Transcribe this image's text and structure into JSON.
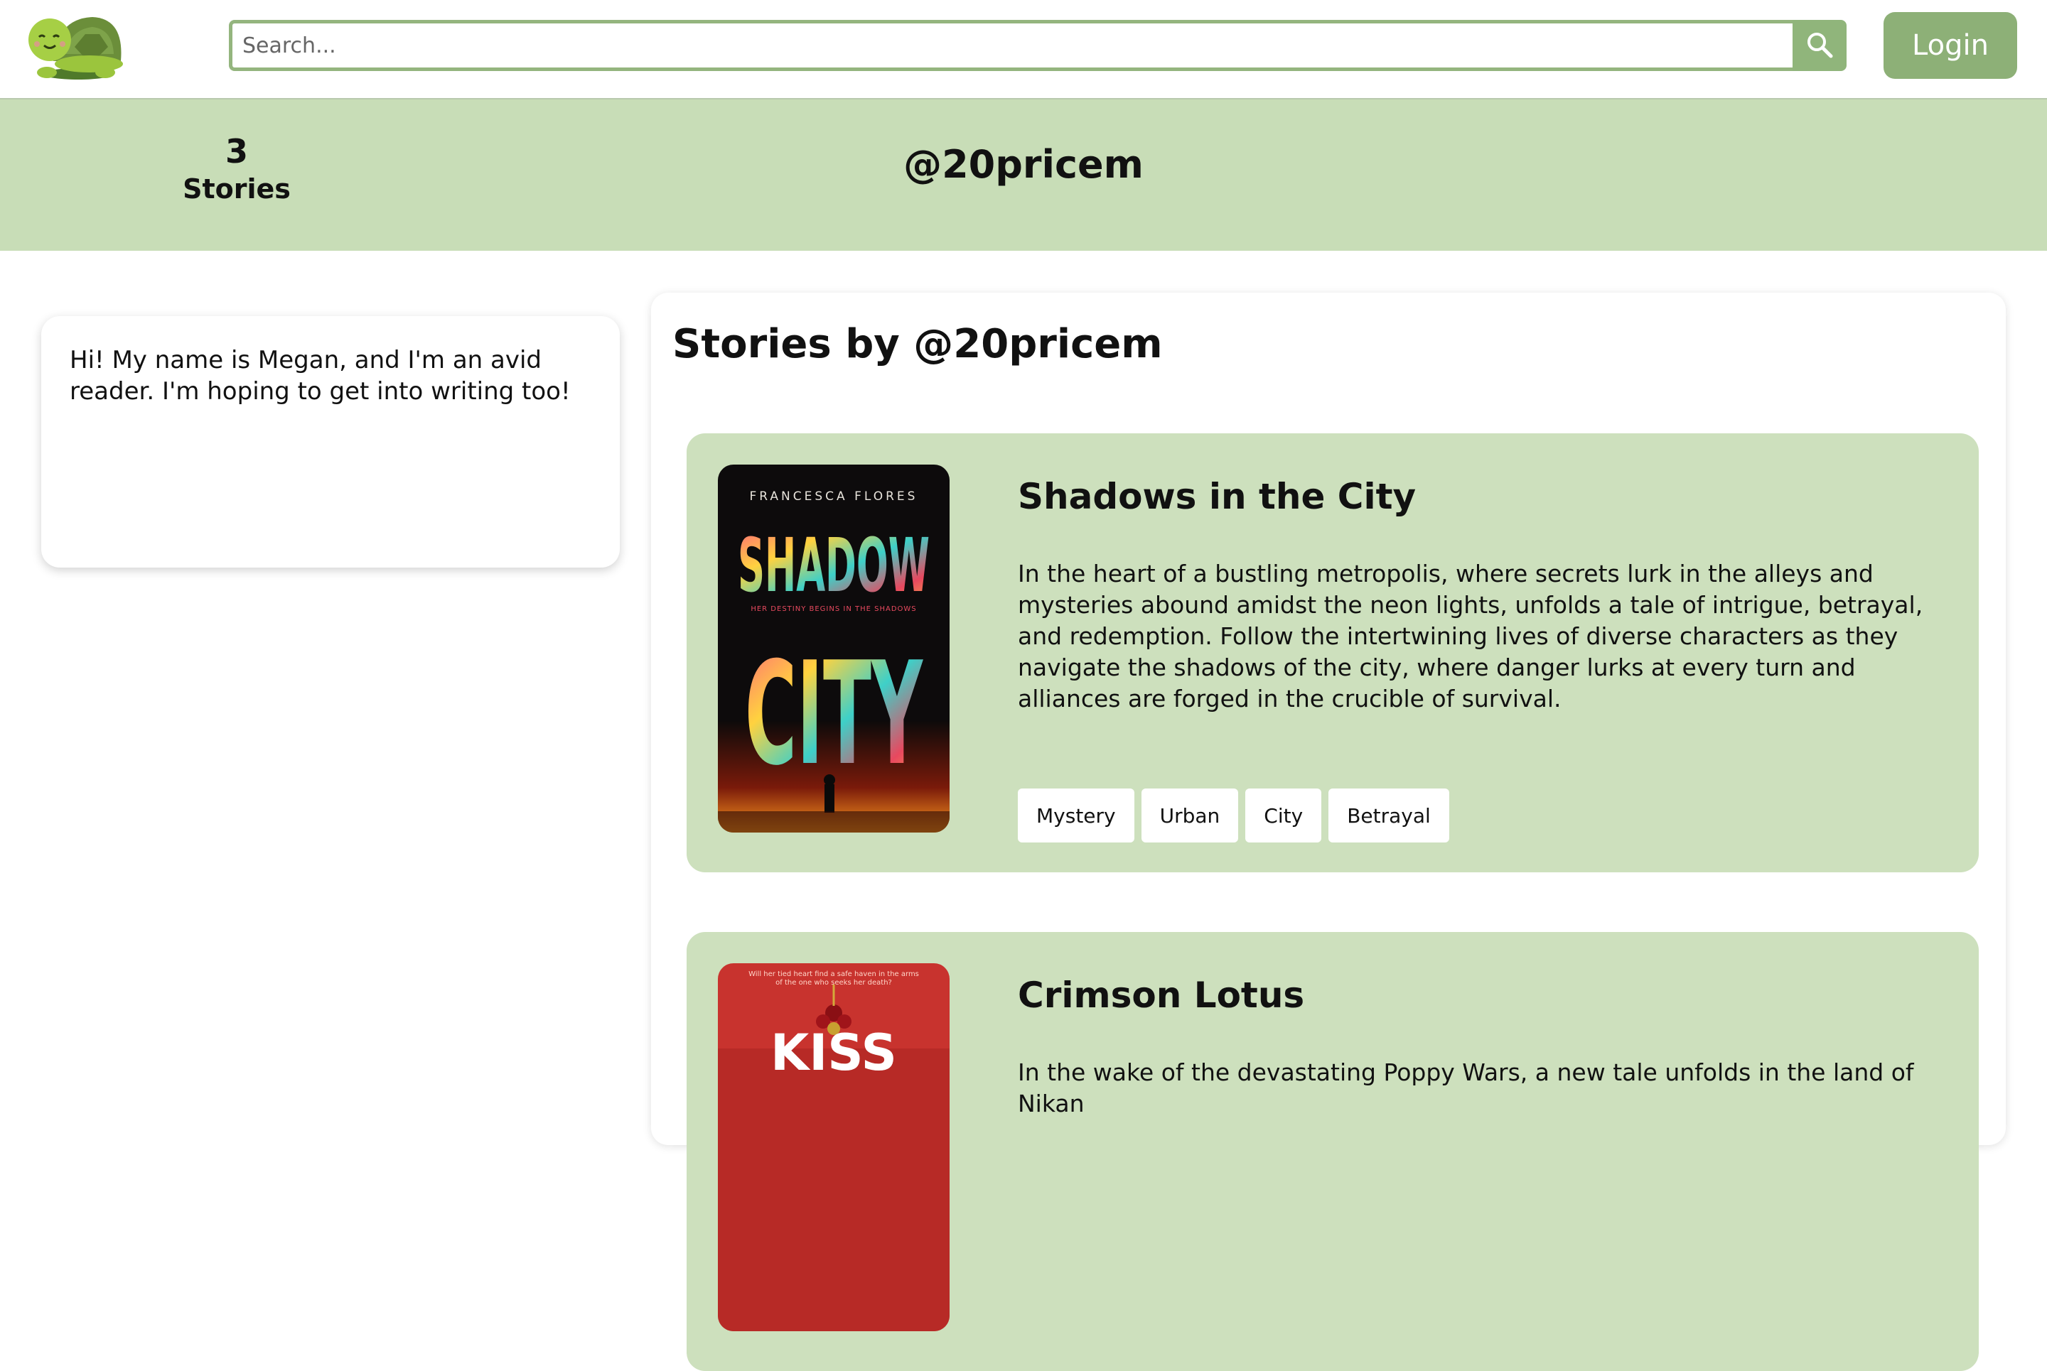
{
  "header": {
    "logo": "turtle-logo",
    "search_placeholder": "Search...",
    "search_icon": "search-icon",
    "login_label": "Login"
  },
  "profile": {
    "story_count": "3",
    "story_count_label": "Stories",
    "username": "@20pricem",
    "bio": "Hi! My name is Megan, and I'm an avid reader. I'm hoping to get into writing too!"
  },
  "stories": {
    "heading": "Stories by @20pricem",
    "items": [
      {
        "title": "Shadows in the City",
        "description": "In the heart of a bustling metropolis, where secrets lurk in the alleys and mysteries abound amidst the neon lights, unfolds a tale of intrigue, betrayal, and redemption. Follow the intertwining lives of diverse characters as they navigate the shadows of the city, where danger lurks at every turn and alliances are forged in the crucible of survival.",
        "tags": [
          "Mystery",
          "Urban",
          "City",
          "Betrayal"
        ],
        "cover": {
          "author": "FRANCESCA FLORES",
          "title_line1": "SHADOW",
          "title_line2": "CITY",
          "tagline": "HER DESTINY BEGINS IN THE SHADOWS"
        }
      },
      {
        "title": "Crimson Lotus",
        "description": "In the wake of the devastating Poppy Wars, a new tale unfolds in the land of Nikan",
        "cover": {
          "tagline": "Will her tied heart find a safe haven in the arms of the one who seeks her death?",
          "title_fragment": "KISS"
        }
      }
    ]
  },
  "colors": {
    "accent": "#8db077",
    "banner": "#c8ddb7",
    "card": "#cde0bd"
  }
}
